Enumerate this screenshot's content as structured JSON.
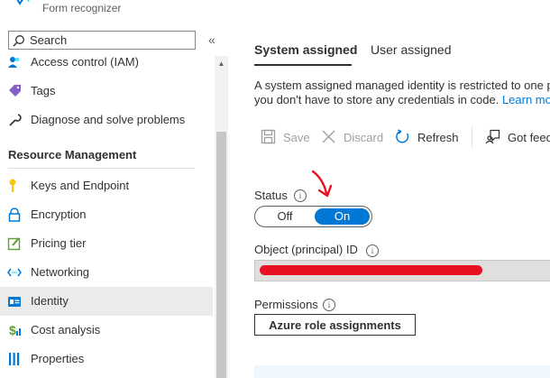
{
  "header": {
    "subtitle": "Form recognizer"
  },
  "search": {
    "placeholder": "Search",
    "collapse_glyph": "«"
  },
  "sidebar": {
    "items_top": [
      {
        "label": "Access control (IAM)",
        "icon": "people-icon"
      },
      {
        "label": "Tags",
        "icon": "tag-icon"
      },
      {
        "label": "Diagnose and solve problems",
        "icon": "wrench-icon"
      }
    ],
    "section_title": "Resource Management",
    "items": [
      {
        "label": "Keys and Endpoint",
        "icon": "key-icon"
      },
      {
        "label": "Encryption",
        "icon": "lock-icon"
      },
      {
        "label": "Pricing tier",
        "icon": "edit-icon"
      },
      {
        "label": "Networking",
        "icon": "networking-icon"
      },
      {
        "label": "Identity",
        "icon": "identity-icon",
        "active": true
      },
      {
        "label": "Cost analysis",
        "icon": "cost-icon"
      },
      {
        "label": "Properties",
        "icon": "properties-icon"
      }
    ]
  },
  "tabs": {
    "system": "System assigned",
    "user": "User assigned",
    "selected": "System assigned"
  },
  "description": {
    "line1": "A system assigned managed identity is restricted to one p",
    "line2_text": "you don't have to store any credentials in code. ",
    "line2_link": "Learn mo"
  },
  "toolbar": {
    "save": "Save",
    "discard": "Discard",
    "refresh": "Refresh",
    "feedback": "Got feedback?"
  },
  "status": {
    "label": "Status",
    "off": "Off",
    "on": "On",
    "value": "On"
  },
  "object_id": {
    "label": "Object (principal) ID"
  },
  "permissions": {
    "label": "Permissions",
    "button": "Azure role assignments"
  },
  "colors": {
    "accent": "#0078d4",
    "annotation_arrow": "#e81123",
    "redaction": "#e81123"
  }
}
